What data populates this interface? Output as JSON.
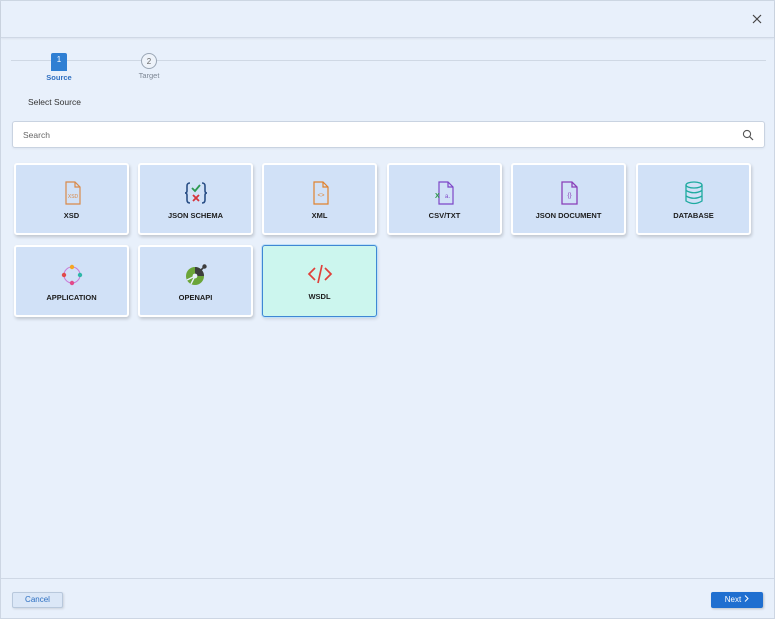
{
  "dialog": {
    "close_icon": "close-icon"
  },
  "stepper": {
    "steps": [
      {
        "number": "1",
        "label": "Source",
        "state": "active"
      },
      {
        "number": "2",
        "label": "Target",
        "state": "inactive"
      }
    ]
  },
  "main": {
    "section_label": "Select Source",
    "search": {
      "placeholder": "Search",
      "value": "",
      "icon": "search-icon"
    },
    "tiles": [
      {
        "label": "XSD",
        "icon": "xsd-file-icon"
      },
      {
        "label": "JSON SCHEMA",
        "icon": "json-schema-icon"
      },
      {
        "label": "XML",
        "icon": "xml-file-icon"
      },
      {
        "label": "CSV/TXT",
        "icon": "csv-file-icon"
      },
      {
        "label": "JSON DOCUMENT",
        "icon": "json-document-icon"
      },
      {
        "label": "DATABASE",
        "icon": "database-icon"
      },
      {
        "label": "APPLICATION",
        "icon": "application-icon"
      },
      {
        "label": "OPENAPI",
        "icon": "openapi-icon"
      },
      {
        "label": "WSDL",
        "icon": "wsdl-code-icon",
        "selected": true
      }
    ]
  },
  "footer": {
    "cancel_label": "Cancel",
    "next_label": "Next",
    "next_icon": "chevron-right-icon"
  },
  "colors": {
    "accent": "#1f6fd0",
    "tile_bg": "#d1e1f7",
    "tile_selected_bg": "#ccf6ee"
  }
}
